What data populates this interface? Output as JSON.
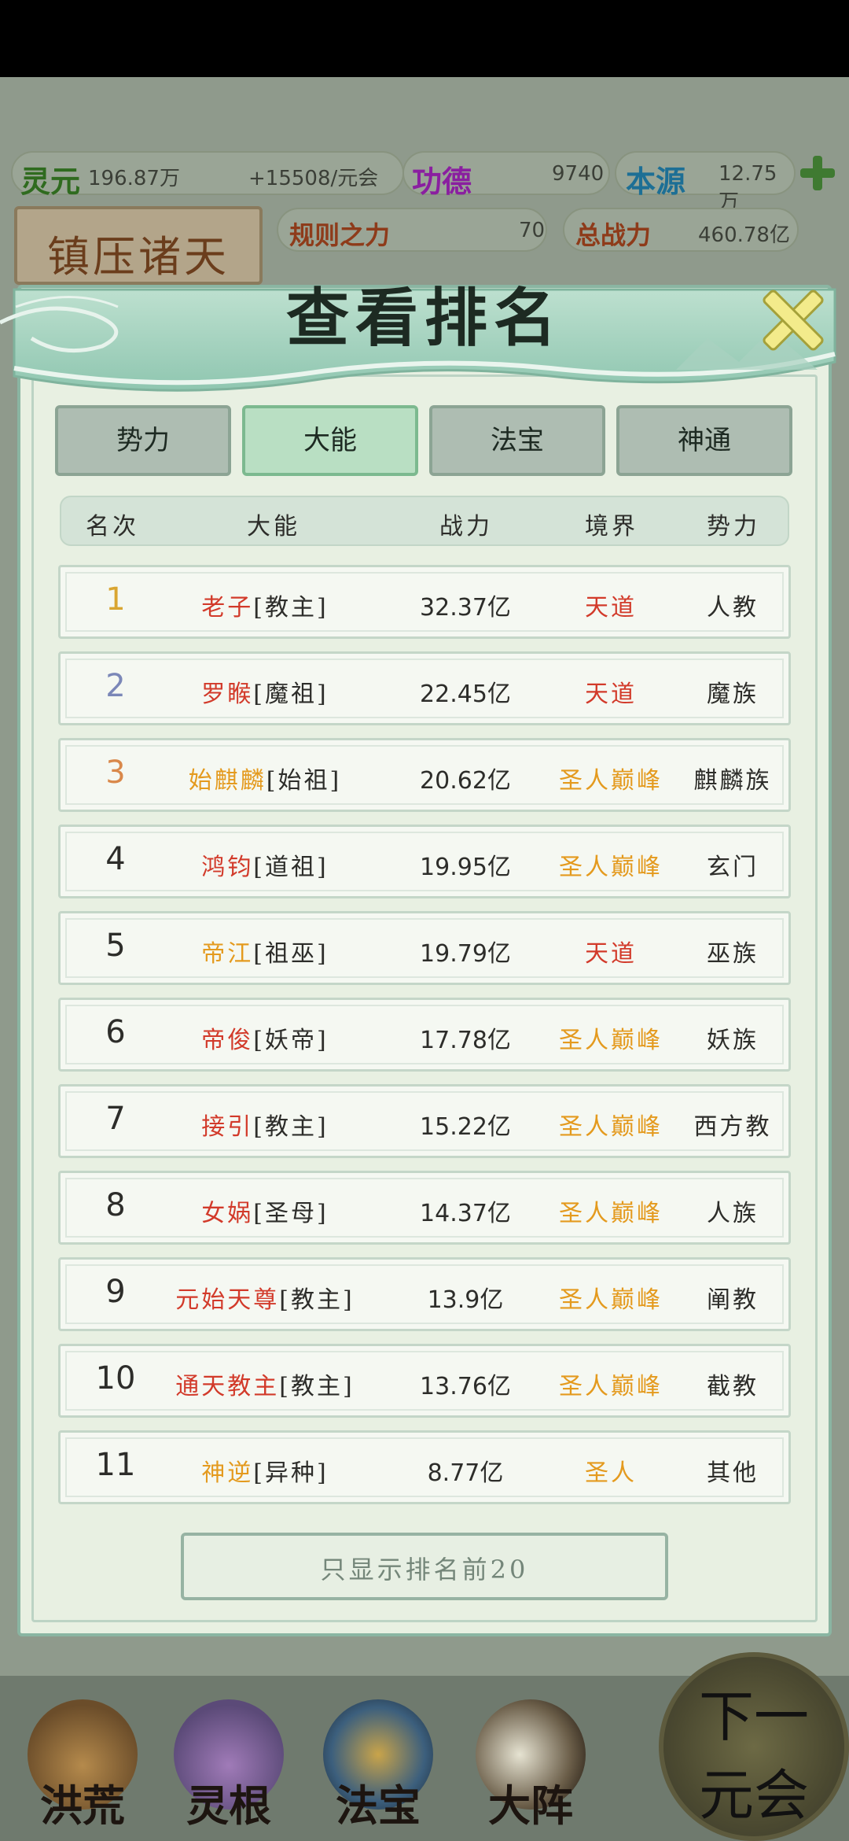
{
  "resources": {
    "lingyuan": {
      "label": "灵元",
      "value": "196.87万",
      "rate": "+15508/元会"
    },
    "gongde": {
      "label": "功德",
      "value": "9740"
    },
    "benyuan": {
      "label": "本源",
      "value": "12.75万"
    },
    "guize": {
      "label": "规则之力",
      "value": "70"
    },
    "zhanli": {
      "label": "总战力",
      "value": "460.78亿"
    }
  },
  "stage": {
    "title": "镇压诸天"
  },
  "modal": {
    "title": "查看排名",
    "tabs": [
      {
        "label": "势力"
      },
      {
        "label": "大能"
      },
      {
        "label": "法宝"
      },
      {
        "label": "神通"
      }
    ],
    "active_tab": "大能",
    "columns": {
      "rank": "名次",
      "name": "大能",
      "power": "战力",
      "realm": "境界",
      "faction": "势力"
    },
    "rows": [
      {
        "rank": "1",
        "name": "老子",
        "title": "[教主]",
        "power": "32.37亿",
        "realm": "天道",
        "faction": "人教",
        "name_color": "#d23a2a",
        "realm_color": "#d23a2a",
        "rank_color": "#d9a531"
      },
      {
        "rank": "2",
        "name": "罗睺",
        "title": "[魔祖]",
        "power": "22.45亿",
        "realm": "天道",
        "faction": "魔族",
        "name_color": "#d23a2a",
        "realm_color": "#d23a2a",
        "rank_color": "#7b87b8"
      },
      {
        "rank": "3",
        "name": "始麒麟",
        "title": "[始祖]",
        "power": "20.62亿",
        "realm": "圣人巅峰",
        "faction": "麒麟族",
        "name_color": "#e49a1e",
        "realm_color": "#e49a1e",
        "rank_color": "#d9884a"
      },
      {
        "rank": "4",
        "name": "鸿钧",
        "title": "[道祖]",
        "power": "19.95亿",
        "realm": "圣人巅峰",
        "faction": "玄门",
        "name_color": "#d23a2a",
        "realm_color": "#e49a1e",
        "rank_color": "#2d2d2a"
      },
      {
        "rank": "5",
        "name": "帝江",
        "title": "[祖巫]",
        "power": "19.79亿",
        "realm": "天道",
        "faction": "巫族",
        "name_color": "#e49a1e",
        "realm_color": "#d23a2a",
        "rank_color": "#2d2d2a"
      },
      {
        "rank": "6",
        "name": "帝俊",
        "title": "[妖帝]",
        "power": "17.78亿",
        "realm": "圣人巅峰",
        "faction": "妖族",
        "name_color": "#d23a2a",
        "realm_color": "#e49a1e",
        "rank_color": "#2d2d2a"
      },
      {
        "rank": "7",
        "name": "接引",
        "title": "[教主]",
        "power": "15.22亿",
        "realm": "圣人巅峰",
        "faction": "西方教",
        "name_color": "#d23a2a",
        "realm_color": "#e49a1e",
        "rank_color": "#2d2d2a"
      },
      {
        "rank": "8",
        "name": "女娲",
        "title": "[圣母]",
        "power": "14.37亿",
        "realm": "圣人巅峰",
        "faction": "人族",
        "name_color": "#d23a2a",
        "realm_color": "#e49a1e",
        "rank_color": "#2d2d2a"
      },
      {
        "rank": "9",
        "name": "元始天尊",
        "title": "[教主]",
        "power": "13.9亿",
        "realm": "圣人巅峰",
        "faction": "阐教",
        "name_color": "#d23a2a",
        "realm_color": "#e49a1e",
        "rank_color": "#2d2d2a"
      },
      {
        "rank": "10",
        "name": "通天教主",
        "title": "[教主]",
        "power": "13.76亿",
        "realm": "圣人巅峰",
        "faction": "截教",
        "name_color": "#d23a2a",
        "realm_color": "#e49a1e",
        "rank_color": "#2d2d2a"
      },
      {
        "rank": "11",
        "name": "神逆",
        "title": "[异种]",
        "power": "8.77亿",
        "realm": "圣人",
        "faction": "其他",
        "name_color": "#e49a1e",
        "realm_color": "#e49a1e",
        "rank_color": "#2d2d2a"
      }
    ],
    "footer_button": "只显示排名前20"
  },
  "nav": [
    {
      "label": "洪荒",
      "icon": "mountain-flame-icon"
    },
    {
      "label": "灵根",
      "icon": "lotus-icon"
    },
    {
      "label": "法宝",
      "icon": "mirror-treasure-icon"
    },
    {
      "label": "大阵",
      "icon": "yin-yang-icon"
    }
  ],
  "next_button": {
    "line1": "下一",
    "line2": "元会"
  }
}
